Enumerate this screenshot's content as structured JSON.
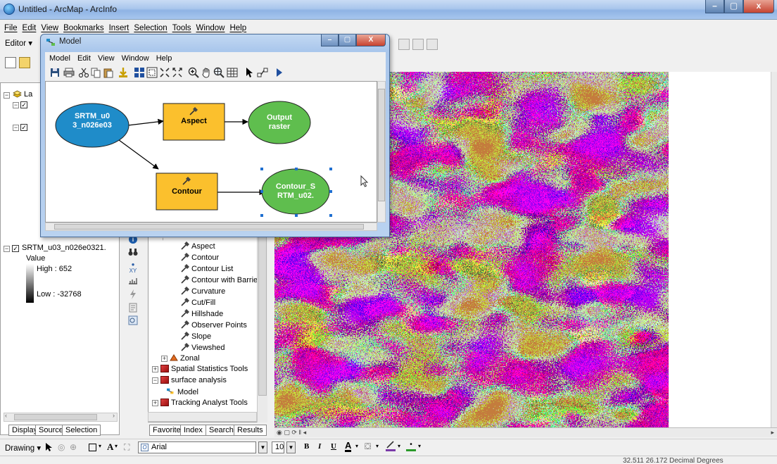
{
  "window": {
    "title": "Untitled - ArcMap - ArcInfo",
    "min": "–",
    "max": "▢",
    "close": "x"
  },
  "menu": [
    "File",
    "Edit",
    "View",
    "Bookmarks",
    "Insert",
    "Selection",
    "Tools",
    "Window",
    "Help"
  ],
  "editor_label": "Editor ▾",
  "toc": {
    "layer_name": "SRTM_u03_n026e0321.",
    "value_label": "Value",
    "high": "High : 652",
    "low": "Low : -32768",
    "partial_layers": "La"
  },
  "toc_tabs": [
    "Display",
    "Source",
    "Selection"
  ],
  "toolbox": {
    "items": [
      "Aspect",
      "Contour",
      "Contour List",
      "Contour with Barrie",
      "Curvature",
      "Cut/Fill",
      "Hillshade",
      "Observer Points",
      "Slope",
      "Viewshed"
    ],
    "zonal": "Zonal",
    "spatial_stats": "Spatial Statistics Tools",
    "surface_analysis": "surface analysis",
    "model": "Model",
    "tracking": "Tracking Analyst Tools"
  },
  "toolbox_tabs": [
    "Favorites",
    "Index",
    "Search",
    "Results"
  ],
  "drawing": {
    "label": "Drawing ▾",
    "font": "Arial",
    "size": "10"
  },
  "status": {
    "coords": "32.511  26.172 Decimal Degrees"
  },
  "model_window": {
    "title": "Model",
    "min": "–",
    "max": "▢",
    "close": "X",
    "menu": [
      "Model",
      "Edit",
      "View",
      "Window",
      "Help"
    ],
    "nodes": {
      "input": "SRTM_u0\n3_n026e03",
      "aspect": "Aspect",
      "output": "Output\nraster",
      "contour": "Contour",
      "contour_out": "Contour_S\nRTM_u02."
    },
    "colors": {
      "input": "#1f8cc9",
      "tool": "#fbc02d",
      "output": "#5fbe4e"
    }
  }
}
